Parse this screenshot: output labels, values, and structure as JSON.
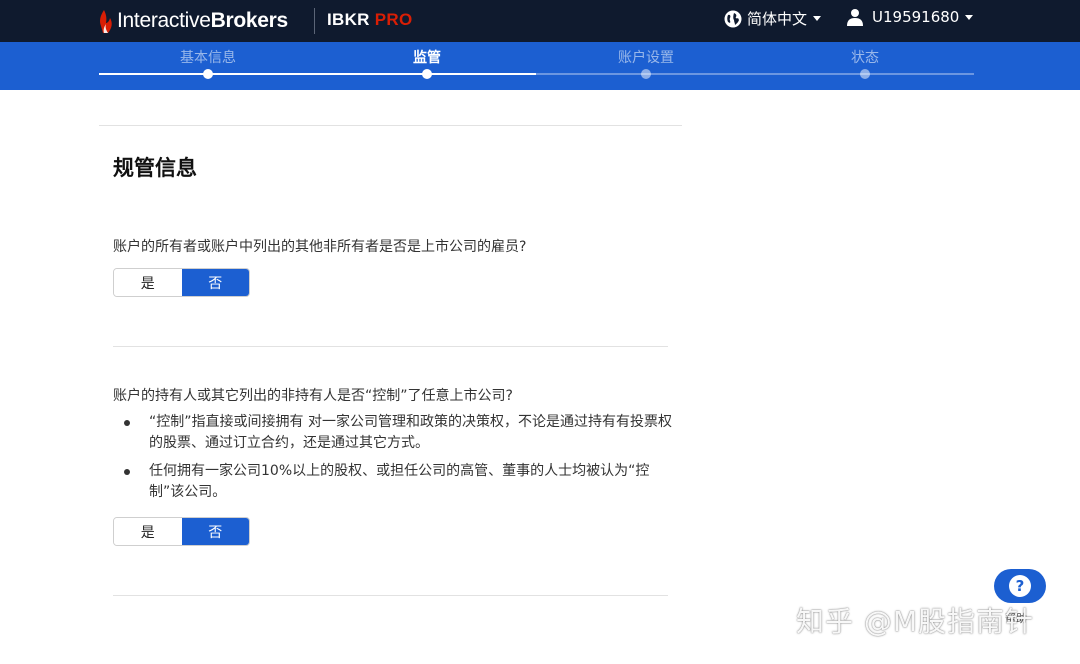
{
  "header": {
    "brand_light": "Interactive",
    "brand_bold": "Brokers",
    "product_prefix": "IBKR",
    "product_suffix": "PRO",
    "language": "简体中文",
    "user_id": "U19591680"
  },
  "steps": [
    {
      "label": "基本信息",
      "state": "done"
    },
    {
      "label": "监管",
      "state": "active"
    },
    {
      "label": "账户设置",
      "state": "todo"
    },
    {
      "label": "状态",
      "state": "todo"
    }
  ],
  "form": {
    "title": "规管信息",
    "q1": {
      "text": "账户的所有者或账户中列出的其他非所有者是否是上市公司的雇员?",
      "yes": "是",
      "no": "否",
      "selected": "否"
    },
    "q2": {
      "text": "账户的持有人或其它列出的非持有人是否“控制”了任意上市公司?",
      "bullets": [
        "“控制”指直接或间接拥有 对一家公司管理和政策的决策权，不论是通过持有有投票权的股票、通过订立合约，还是通过其它方式。",
        "任何拥有一家公司10%以上的股权、或担任公司的高管、董事的人士均被认为“控制”该公司。"
      ],
      "yes": "是",
      "no": "否",
      "selected": "否"
    }
  },
  "help": {
    "icon_char": "?",
    "label": "帮助"
  },
  "watermark": "知乎 @M股指南针",
  "colors": {
    "header_bg": "#0f1a2e",
    "accent": "#1c5fd1",
    "pro_red": "#d81e05"
  }
}
